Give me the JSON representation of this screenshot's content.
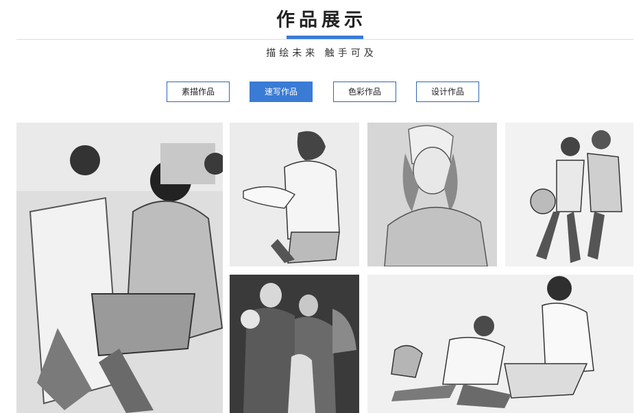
{
  "header": {
    "title": "作品展示",
    "subtitle": "描绘未来 触手可及"
  },
  "tabs": [
    {
      "label": "素描作品",
      "active": false
    },
    {
      "label": "速写作品",
      "active": true
    },
    {
      "label": "色彩作品",
      "active": false
    },
    {
      "label": "设计作品",
      "active": false
    }
  ],
  "colors": {
    "accent": "#3a7bd5",
    "tab_border": "#2f65b6",
    "title_text": "#222222"
  },
  "gallery": {
    "items": [
      {
        "name": "sketch-seated-girl-with-easel"
      },
      {
        "name": "sketch-student-drawing-back-view"
      },
      {
        "name": "sketch-girl-portrait-pencil"
      },
      {
        "name": "sketch-basketball-players"
      },
      {
        "name": "sketch-family-charcoal"
      },
      {
        "name": "sketch-two-seated-figures"
      }
    ]
  }
}
